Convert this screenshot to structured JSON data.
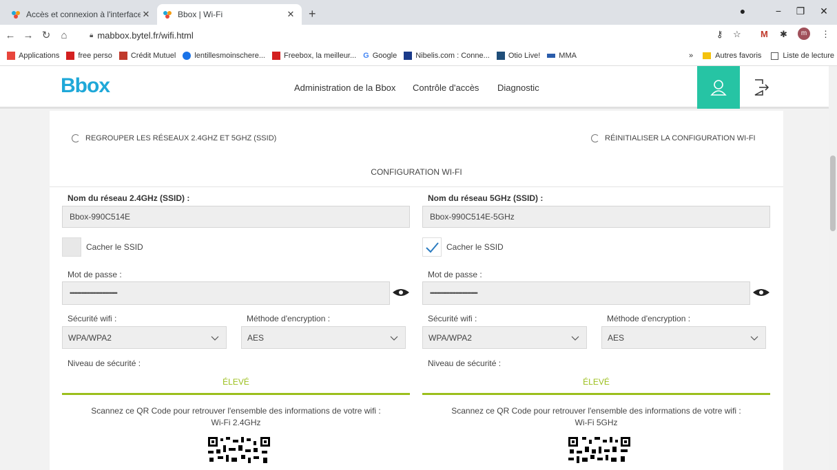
{
  "browser": {
    "tabs": [
      {
        "title": "Accès et connexion à l'interface d",
        "close": "✕"
      },
      {
        "title": "Bbox | Wi-Fi",
        "close": "✕"
      }
    ],
    "new_tab": "+",
    "window": {
      "minimize": "−",
      "maximize": "❐",
      "close": "✕"
    },
    "url": "mabbox.bytel.fr/wifi.html",
    "profile_initial": "m",
    "bookmarks": [
      {
        "label": "Applications",
        "color": "#e8453c"
      },
      {
        "label": "free perso",
        "color": "#d32020"
      },
      {
        "label": "Crédit Mutuel",
        "color": "#c0392b"
      },
      {
        "label": "lentillesmoinschere...",
        "color": "#1a73e8"
      },
      {
        "label": "Freebox, la meilleur...",
        "color": "#d32020"
      },
      {
        "label": "Google",
        "color": "#4285f4"
      },
      {
        "label": "Nibelis.com : Conne...",
        "color": "#1a3a8a"
      },
      {
        "label": "Otio Live!",
        "color": "#1f4e79"
      },
      {
        "label": "MMA",
        "color": "#2a5caa"
      }
    ],
    "more_bookmarks": "»",
    "other_favorites": "Autres favoris",
    "reading_list": "Liste de lecture"
  },
  "site": {
    "logo": "Bbox",
    "nav": [
      "Administration de la Bbox",
      "Contrôle d'accès",
      "Diagnostic"
    ],
    "accent": "#26c4a4"
  },
  "wifi": {
    "group_networks": "REGROUPER LES RÉSEAUX 2.4GHZ ET 5GHZ (SSID)",
    "reset_config": "RÉINITIALISER LA CONFIGURATION WI-FI",
    "config_title": "CONFIGURATION WI-FI",
    "networks": [
      {
        "ssid_label": "Nom du réseau 2.4GHz (SSID) :",
        "ssid_value": "Bbox-990C514E",
        "hide_ssid_label": "Cacher le SSID",
        "hide_ssid_checked": false,
        "password_label": "Mot de passe :",
        "password_value": "••••••••••••••••••••••••••••••••",
        "security_label": "Sécurité wifi :",
        "security_value": "WPA/WPA2",
        "encryption_label": "Méthode d'encryption :",
        "encryption_value": "AES",
        "level_label": "Niveau de sécurité :",
        "level_value": "ÉLEVÉ",
        "qr_text": "Scannez ce QR Code pour retrouver l'ensemble des informations de votre wifi :",
        "qr_network": "Wi-Fi 2.4GHz"
      },
      {
        "ssid_label": "Nom du réseau 5GHz (SSID) :",
        "ssid_value": "Bbox-990C514E-5GHz",
        "hide_ssid_label": "Cacher le SSID",
        "hide_ssid_checked": true,
        "password_label": "Mot de passe :",
        "password_value": "••••••••••••••••••••••••••••••••",
        "security_label": "Sécurité wifi :",
        "security_value": "WPA/WPA2",
        "encryption_label": "Méthode d'encryption :",
        "encryption_value": "AES",
        "level_label": "Niveau de sécurité :",
        "level_value": "ÉLEVÉ",
        "qr_text": "Scannez ce QR Code pour retrouver l'ensemble des informations de votre wifi :",
        "qr_network": "Wi-Fi 5GHz"
      }
    ]
  }
}
